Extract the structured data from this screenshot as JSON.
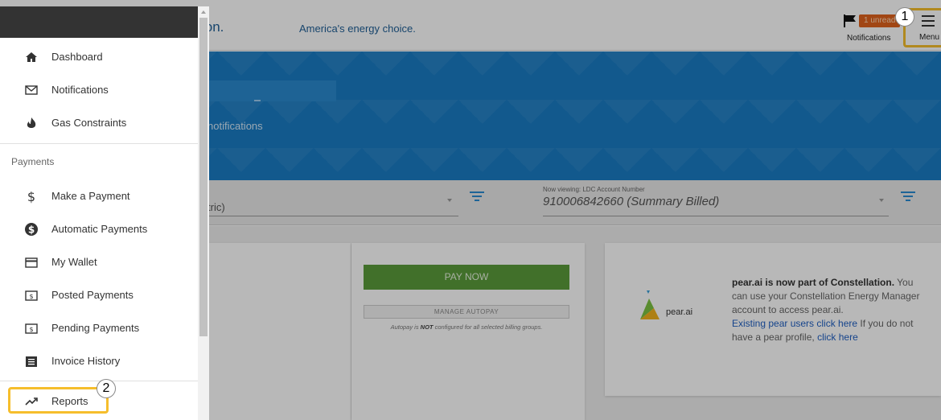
{
  "header": {
    "brand_fragment": "ion.",
    "tagline": "America's energy choice.",
    "unread_badge": "1 unread",
    "notifications_label": "Notifications",
    "menu_label": "Menu"
  },
  "hero": {
    "subtitle_fragment": "notifications"
  },
  "filters": {
    "commodity_fragment": "tric)",
    "account_caption": "Now viewing: LDC Account Number",
    "account_value": "910006842660 (Summary Billed)"
  },
  "payment_card": {
    "pay_now": "PAY NOW",
    "manage_autopay": "MANAGE AUTOPAY",
    "note_prefix": "Autopay is ",
    "note_emphasis": "NOT",
    "note_suffix": " configured for all selected billing groups."
  },
  "pear_card": {
    "logo_text": "pear.ai",
    "headline": "pear.ai is now part of Constellation.",
    "body": " You can use your Constellation Energy Manager account to access pear.ai.",
    "link1": "Existing pear users click here",
    "mid": " If you do not have a pear profile, ",
    "link2": "click here"
  },
  "drawer": {
    "top_items": [
      {
        "label": "Dashboard",
        "icon": "home-icon"
      },
      {
        "label": "Notifications",
        "icon": "envelope-icon"
      },
      {
        "label": "Gas Constraints",
        "icon": "flame-icon"
      }
    ],
    "section_payments": "Payments",
    "payment_items": [
      {
        "label": "Make a Payment",
        "icon": "dollar-icon"
      },
      {
        "label": "Automatic Payments",
        "icon": "dollar-circle-icon"
      },
      {
        "label": "My Wallet",
        "icon": "credit-card-icon"
      },
      {
        "label": "Posted Payments",
        "icon": "bill-icon"
      },
      {
        "label": "Pending Payments",
        "icon": "bill-icon"
      },
      {
        "label": "Invoice History",
        "icon": "invoice-icon"
      }
    ],
    "reports": {
      "label": "Reports",
      "icon": "trend-up-icon"
    }
  },
  "callouts": {
    "step1": "1",
    "step2": "2"
  },
  "colors": {
    "highlight": "#f6be2c",
    "hero_blue": "#1a7cc4",
    "pay_green": "#5a9b3b",
    "badge_orange": "#e0611c"
  }
}
